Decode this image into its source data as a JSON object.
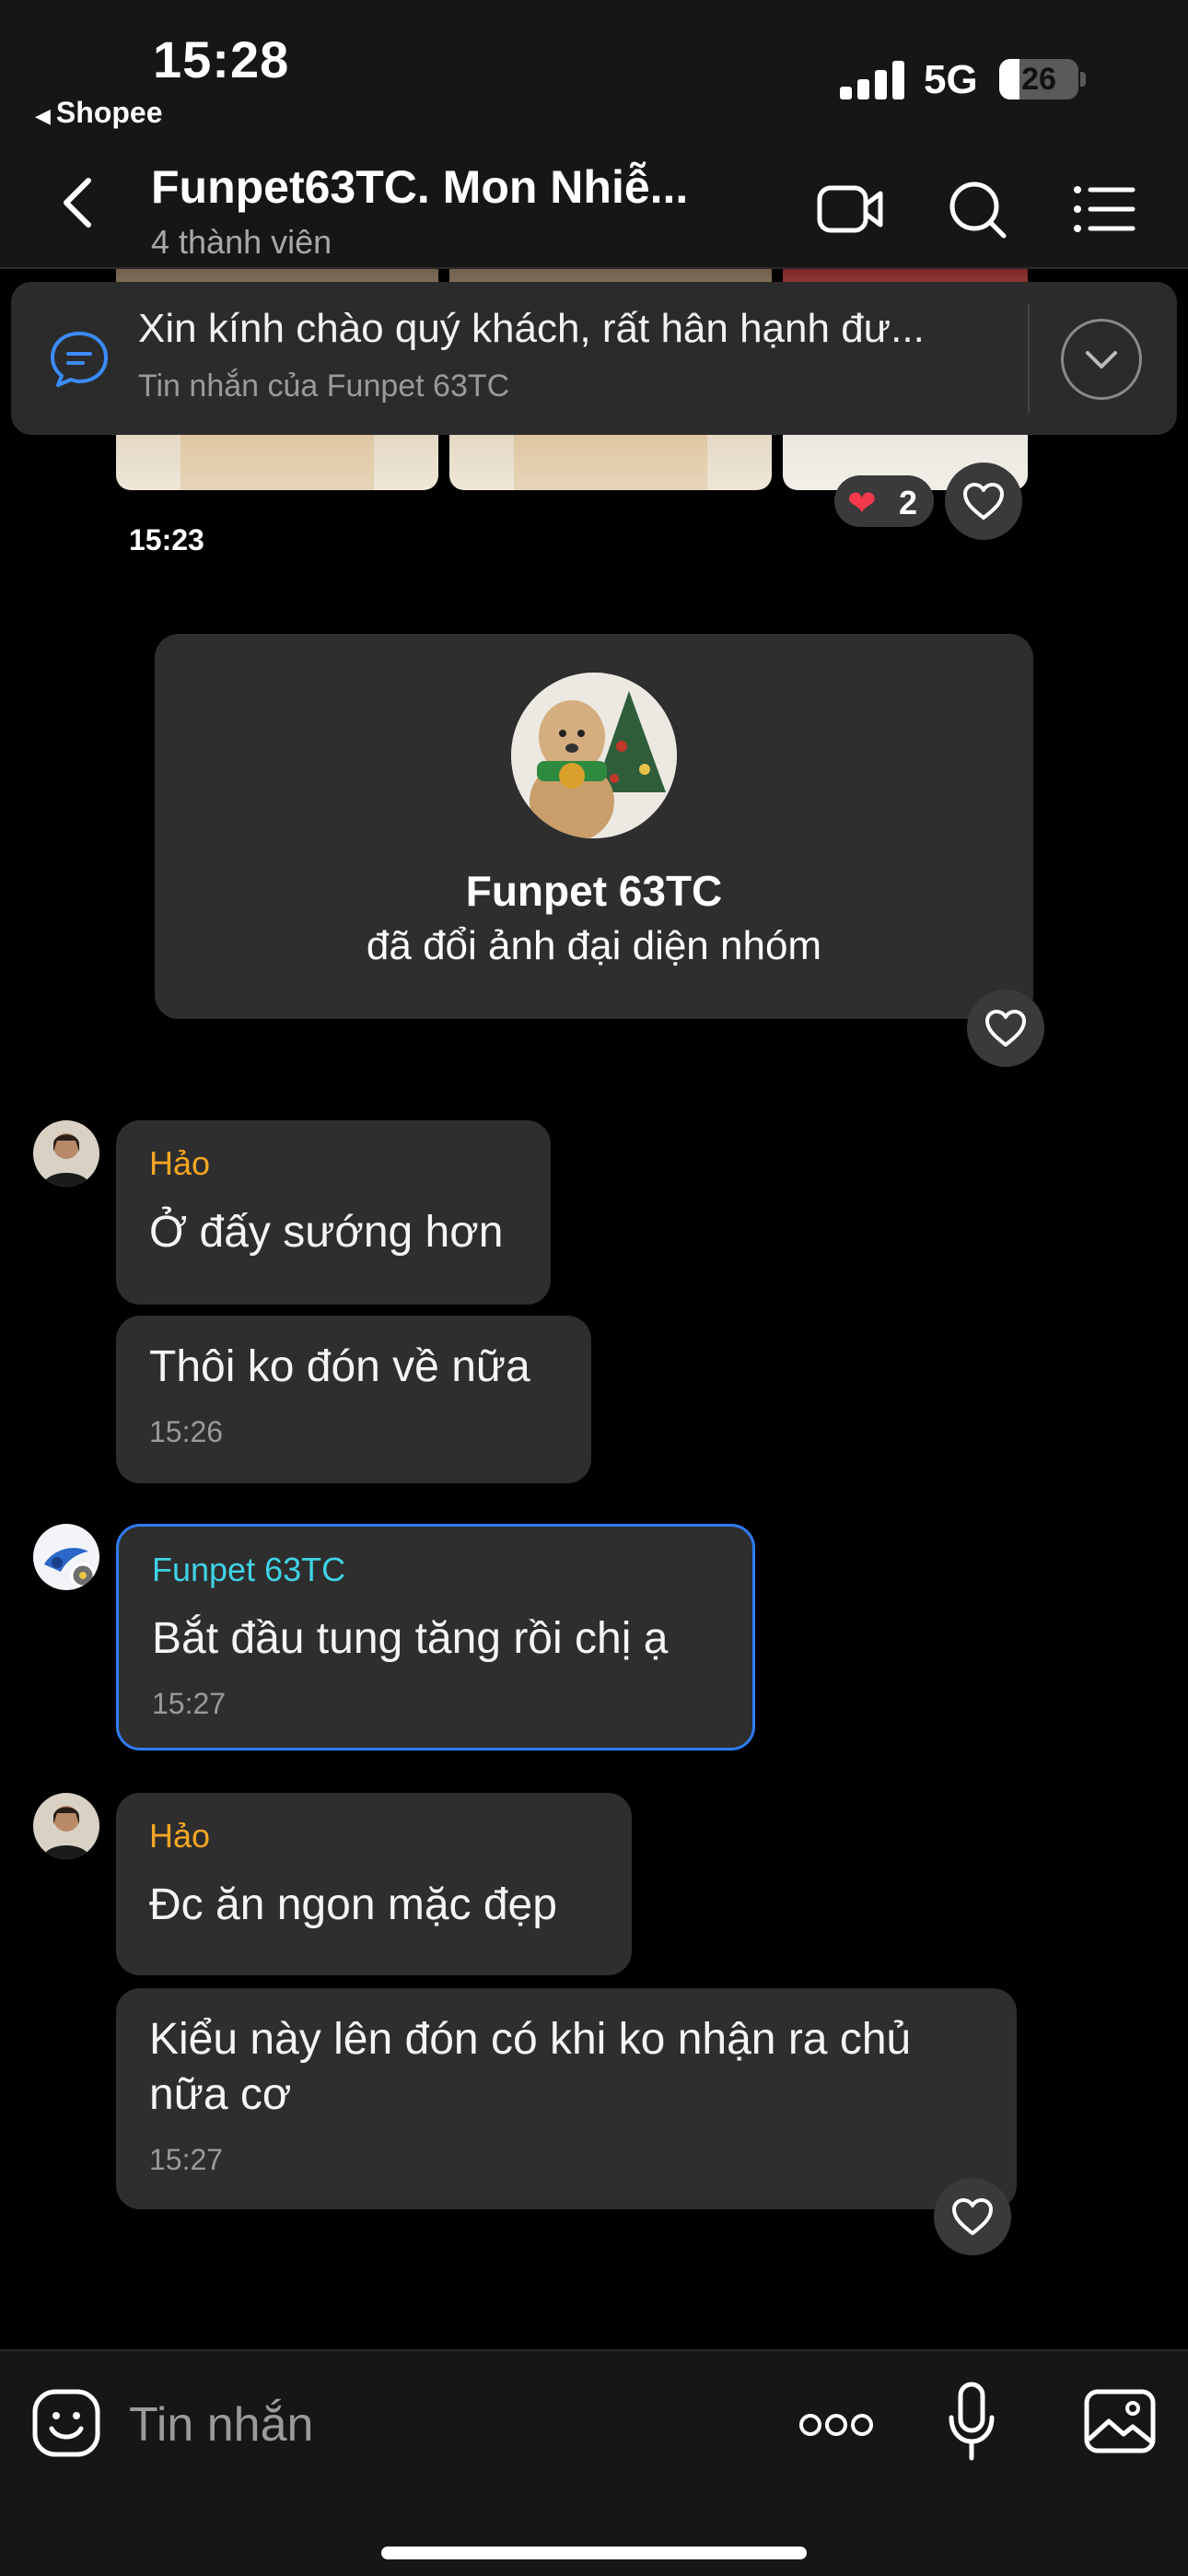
{
  "status_bar": {
    "time": "15:28",
    "back_app": "Shopee",
    "network": "5G",
    "battery": 26
  },
  "header": {
    "title": "Funpet63TC. Mon Nhiễ...",
    "subtitle": "4 thành viên",
    "icons": [
      "back-chevron-icon",
      "video-call-icon",
      "search-icon",
      "menu-list-icon"
    ]
  },
  "pinned": {
    "text": "Xin kính chào quý khách, rất hân hạnh đư...",
    "sub": "Tin nhắn của Funpet 63TC"
  },
  "photo_group": {
    "time": "15:23",
    "reaction": {
      "emoji": "❤",
      "count": "2"
    }
  },
  "system_event": {
    "name": "Funpet 63TC",
    "action": "đã đổi ảnh đại diện nhóm"
  },
  "messages": [
    {
      "sender": "Hảo",
      "text": "Ở đấy sướng hơn"
    },
    {
      "text": "Thôi ko đón về nữa",
      "time": "15:26"
    },
    {
      "sender": "Funpet 63TC",
      "text": "Bắt đầu tung tăng rồi chị ạ",
      "time": "15:27"
    },
    {
      "sender": "Hảo",
      "text": "Đc ăn ngon mặc đẹp"
    },
    {
      "text": "Kiểu này lên đón có khi ko nhận ra chủ nữa cơ",
      "time": "15:27"
    }
  ],
  "colors": {
    "hao_name": "#f5a623",
    "funpet_name": "#3fd3e6",
    "highlight_border": "#2d7cf6",
    "bubble": "#2e2e2e",
    "reaction_heart": "#f23a4c"
  },
  "composer": {
    "placeholder": "Tin nhắn",
    "icons": [
      "sticker-icon",
      "more-icon",
      "microphone-icon",
      "image-icon"
    ]
  }
}
